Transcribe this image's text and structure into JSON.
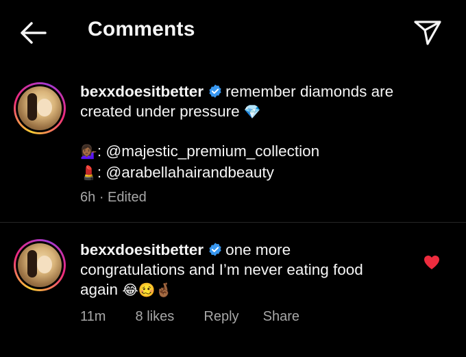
{
  "header": {
    "title": "Comments",
    "back_icon": "arrow-left-icon",
    "share_icon": "paper-plane-icon"
  },
  "caption": {
    "username": "bexxdoesitbetter",
    "text_line1": "remember diamonds are",
    "text_line2": "created under pressure",
    "emoji_diamond": "💎",
    "credit1_emoji": "💁🏾‍♀️",
    "credit1_text": ": @majestic_premium_collection",
    "credit2_emoji": "💄",
    "credit2_text": ": @arabellahairandbeauty",
    "time": "6h",
    "separator": "·",
    "edited": "Edited"
  },
  "comment": {
    "username": "bexxdoesitbetter",
    "text_line1": "one more",
    "text_line2": "congratulations and I’m never eating food",
    "text_line3": "again",
    "emojis": "😂🥴🤞🏾",
    "time": "11m",
    "likes": "8 likes",
    "reply_label": "Reply",
    "share_label": "Share",
    "liked": true
  },
  "colors": {
    "background": "#000000",
    "text": "#f5f5f5",
    "muted": "#a8a8a8",
    "verified": "#3897f0",
    "heart": "#ed2c3e"
  }
}
